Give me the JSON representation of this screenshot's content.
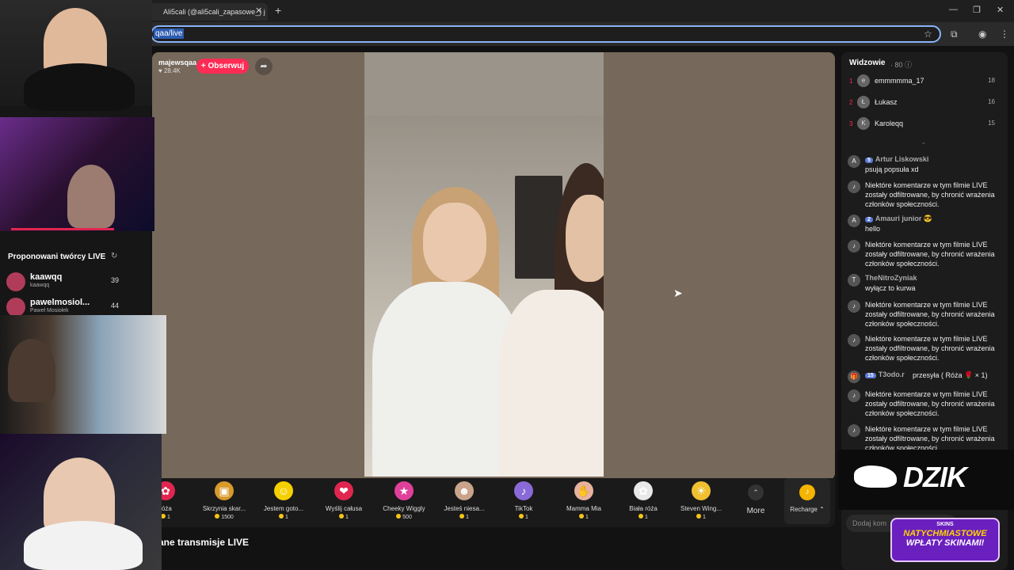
{
  "browser": {
    "tab_title": "Ali5cali (@ali5cali_zapasowe_) j",
    "tab_close": "✕",
    "new_tab": "+",
    "url": "qaa/live",
    "win_min": "—",
    "win_max": "❐",
    "win_close": "✕",
    "star_icon": "☆",
    "ext_icon": "⧉",
    "profile_icon": "◉",
    "menu_icon": "⋮"
  },
  "stream": {
    "host_name": "majewsqaa",
    "host_likes": "♥ 28.4K",
    "follow_label": "+ Obserwuj",
    "share_icon": "➦"
  },
  "gifts": [
    {
      "name": "róża",
      "price": "1",
      "color": "#e0264f",
      "icon": "✿"
    },
    {
      "name": "Skrzynia skar...",
      "price": "1500",
      "color": "#d89a2a",
      "icon": "▣"
    },
    {
      "name": "Jestem goto...",
      "price": "1",
      "color": "#f5d000",
      "icon": "☺"
    },
    {
      "name": "Wyślij całusa",
      "price": "1",
      "color": "#e0264f",
      "icon": "❤"
    },
    {
      "name": "Cheeky Wiggly",
      "price": "500",
      "color": "#e0409a",
      "icon": "★"
    },
    {
      "name": "Jesteś niesa...",
      "price": "1",
      "color": "#c9a48a",
      "icon": "☻"
    },
    {
      "name": "TikTok",
      "price": "1",
      "color": "#8a6ad8",
      "icon": "♪"
    },
    {
      "name": "Mamma Mia",
      "price": "1",
      "color": "#e8b2a0",
      "icon": "✋"
    },
    {
      "name": "Biała róża",
      "price": "1",
      "color": "#e8e8e8",
      "icon": "✿"
    },
    {
      "name": "Steven Wing...",
      "price": "1",
      "color": "#f0c030",
      "icon": "☀"
    }
  ],
  "more": {
    "icon": "⌃",
    "label": "More"
  },
  "recharge": {
    "icon": "♪",
    "label": "Recharge ⌃"
  },
  "section_title": "ane transmisje LIVE",
  "viewers": {
    "title": "Widzowie",
    "count": "· 80 ⓘ",
    "list": [
      {
        "rank": "1",
        "name": "emmmmma_17",
        "score": "18",
        "avatar": "e"
      },
      {
        "rank": "2",
        "name": "Łukasz",
        "score": "16",
        "avatar": "Ł"
      },
      {
        "rank": "3",
        "name": "Karoleqq",
        "score": "15",
        "avatar": "K"
      }
    ],
    "chevron": "⌄"
  },
  "chat": [
    {
      "user": "Artur Liskowski",
      "badge": "5",
      "text": "psują popsuła xd",
      "avatar": "A"
    },
    {
      "user": "",
      "badge": "",
      "text": "Niektóre komentarze w tym filmie LIVE zostały odfiltrowane, by chronić wrażenia członków społeczności.",
      "avatar": "♪"
    },
    {
      "user": "Amauri junior 😎",
      "badge": "2",
      "text": "hello",
      "avatar": "A"
    },
    {
      "user": "",
      "badge": "",
      "text": "Niektóre komentarze w tym filmie LIVE zostały odfiltrowane, by chronić wrażenia członków społeczności.",
      "avatar": "♪"
    },
    {
      "user": "TheNitroZyniak",
      "badge": "",
      "text": "wyłącz to kurwa",
      "avatar": "T"
    },
    {
      "user": "",
      "badge": "",
      "text": "Niektóre komentarze w tym filmie LIVE zostały odfiltrowane, by chronić wrażenia członków społeczności.",
      "avatar": "♪"
    },
    {
      "user": "",
      "badge": "",
      "text": "Niektóre komentarze w tym filmie LIVE zostały odfiltrowane, by chronić wrażenia członków społeczności.",
      "avatar": "♪"
    },
    {
      "user": "T3odo.r",
      "badge": "15",
      "text": "przesyła ( Róża 🌹 × 1)",
      "avatar": "🎁"
    },
    {
      "user": "",
      "badge": "",
      "text": "Niektóre komentarze w tym filmie LIVE zostały odfiltrowane, by chronić wrażenia członków społeczności.",
      "avatar": "♪"
    },
    {
      "user": "",
      "badge": "",
      "text": "Niektóre komentarze w tym filmie LIVE zostały odfiltrowane, by chronić wrażenia członków społeczności.",
      "avatar": "♪"
    }
  ],
  "comment_placeholder": "Dodaj kom",
  "overlay": {
    "dzik": "DZIK",
    "promo_brand": "SKINS",
    "promo_line1": "NATYCHMIASTOWE",
    "promo_line2": "WPŁATY SKINAMI!"
  },
  "sidebar": {
    "title": "Proponowani twórcy LIVE",
    "refresh_icon": "↻",
    "items": [
      {
        "name": "kaawqq",
        "sub": "kaawqq",
        "count": "39"
      },
      {
        "name": "pawelmosiol...",
        "sub": "Paweł Mosiołek",
        "count": "44"
      }
    ]
  }
}
